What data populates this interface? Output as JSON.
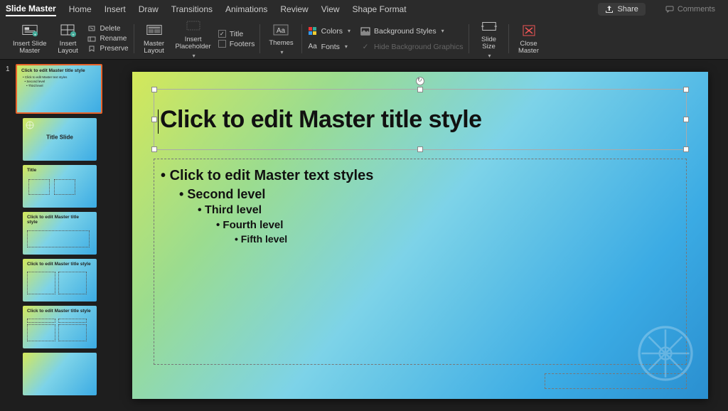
{
  "menu": {
    "tabs": [
      "Slide Master",
      "Home",
      "Insert",
      "Draw",
      "Transitions",
      "Animations",
      "Review",
      "View",
      "Shape Format"
    ],
    "share": "Share",
    "comments": "Comments"
  },
  "ribbon": {
    "insert_slide_master": "Insert Slide\nMaster",
    "insert_layout": "Insert\nLayout",
    "delete": "Delete",
    "rename": "Rename",
    "preserve": "Preserve",
    "master_layout": "Master\nLayout",
    "insert_placeholder": "Insert\nPlaceholder",
    "title_cb": "Title",
    "footers_cb": "Footers",
    "themes": "Themes",
    "colors": "Colors",
    "fonts": "Fonts",
    "bg_styles": "Background Styles",
    "hide_bg": "Hide Background Graphics",
    "slide_size": "Slide\nSize",
    "close_master": "Close\nMaster"
  },
  "thumbs": {
    "num1": "1",
    "master_title": "Click to edit Master title style",
    "master_sub": "Click to edit Master text styles",
    "layout_titleslide": "Title Slide",
    "layout_title": "Title",
    "layout_click": "Click to edit Master title\nstyle",
    "layout_click2": "Click to edit Master title style",
    "layout_click3": "Click to edit Master title style"
  },
  "slide": {
    "title": "Click to edit Master title style",
    "l1": "Click to edit Master text styles",
    "l2": "Second level",
    "l3": "Third level",
    "l4": "Fourth level",
    "l5": "Fifth level"
  }
}
